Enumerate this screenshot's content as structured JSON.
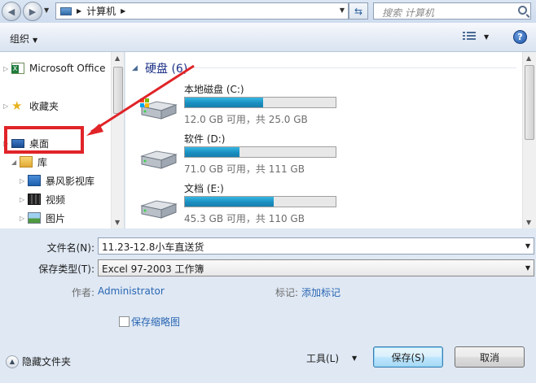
{
  "address_bar": {
    "crumb": "计算机",
    "search_placeholder": "搜索 计算机"
  },
  "toolbar": {
    "organize_label": "组织",
    "help_label": "?"
  },
  "nav_pane": {
    "items": [
      {
        "label": "Microsoft Office",
        "icon": "excel-icon"
      },
      {
        "label": "收藏夹",
        "icon": "star-icon"
      },
      {
        "label": "桌面",
        "icon": "desktop-icon"
      },
      {
        "label": "库",
        "icon": "library-icon"
      },
      {
        "label": "暴风影视库",
        "icon": "video-library-icon"
      },
      {
        "label": "视频",
        "icon": "video-icon"
      },
      {
        "label": "图片",
        "icon": "picture-icon"
      }
    ]
  },
  "content": {
    "group_title": "硬盘 (6)",
    "drives": [
      {
        "name": "本地磁盘 (C:)",
        "free_text": "12.0 GB 可用，共 25.0 GB",
        "used_fraction": 0.52
      },
      {
        "name": "软件 (D:)",
        "free_text": "71.0 GB 可用，共 111 GB",
        "used_fraction": 0.36
      },
      {
        "name": "文档 (E:)",
        "free_text": "45.3 GB 可用，共 110 GB",
        "used_fraction": 0.59
      }
    ]
  },
  "form": {
    "filename_label": "文件名(N):",
    "filename_value": "11.23-12.8小车直送货",
    "savetype_label": "保存类型(T):",
    "savetype_value": "Excel 97-2003 工作簿",
    "author_label": "作者:",
    "author_value": "Administrator",
    "tags_label": "标记:",
    "tags_value": "添加标记",
    "thumbnail_label": "保存缩略图",
    "hide_folders_label": "隐藏文件夹",
    "tools_label": "工具(L)",
    "save_label": "保存(S)",
    "cancel_label": "取消"
  },
  "colors": {
    "annotation_red": "#e02428",
    "drive_bar_blue": "#26a0da",
    "link_blue": "#2a66b3"
  }
}
